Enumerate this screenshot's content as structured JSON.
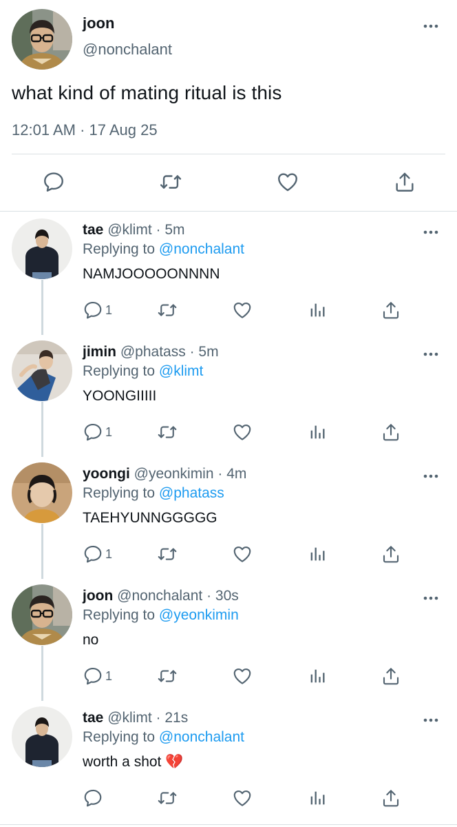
{
  "main_tweet": {
    "author_name": "joon",
    "author_handle": "@nonchalant",
    "text": "what kind of mating ritual is this",
    "timestamp": "12:01 AM · 17 Aug 25",
    "actions": [
      "comment-icon",
      "retweet-icon",
      "heart-icon",
      "share-icon"
    ]
  },
  "replies": [
    {
      "name": "tae",
      "handle": "@klimt",
      "time": "· 5m",
      "replying_label": "Replying to",
      "replying_to": "@nonchalant",
      "text": "NAMJOOOOONNNN",
      "reply_count": "1"
    },
    {
      "name": "jimin",
      "handle": "@phatass",
      "time": "· 5m",
      "replying_label": "Replying to",
      "replying_to": "@klimt",
      "text": "YOONGIIIII",
      "reply_count": "1"
    },
    {
      "name": "yoongi",
      "handle": "@yeonkimin",
      "time": "· 4m",
      "replying_label": "Replying to",
      "replying_to": "@phatass",
      "text": "TAEHYUNNGGGGG",
      "reply_count": "1"
    },
    {
      "name": "joon",
      "handle": "@nonchalant",
      "time": "· 30s",
      "replying_label": "Replying to",
      "replying_to": "@yeonkimin",
      "text": "no",
      "reply_count": "1"
    },
    {
      "name": "tae",
      "handle": "@klimt",
      "time": "· 21s",
      "replying_label": "Replying to",
      "replying_to": "@nonchalant",
      "text": "worth a shot 💔",
      "reply_count": ""
    }
  ],
  "colors": {
    "text": "#0f1419",
    "muted": "#536471",
    "link": "#1d9bf0",
    "divider": "#d9dfe3",
    "thread_line": "#cfd9de"
  }
}
